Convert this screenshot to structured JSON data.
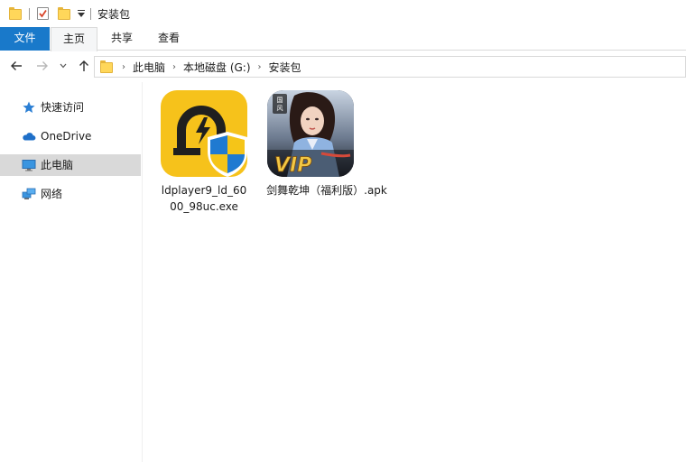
{
  "window": {
    "title": "安装包"
  },
  "ribbon": {
    "tabs": [
      "文件",
      "主页",
      "共享",
      "查看"
    ]
  },
  "address": {
    "crumbs": [
      "此电脑",
      "本地磁盘 (G:)",
      "安装包"
    ]
  },
  "sidebar": {
    "items": [
      {
        "label": "快速访问",
        "icon": "star-icon"
      },
      {
        "label": "OneDrive",
        "icon": "cloud-icon"
      },
      {
        "label": "此电脑",
        "icon": "monitor-icon",
        "selected": true
      },
      {
        "label": "网络",
        "icon": "network-icon"
      }
    ]
  },
  "files": [
    {
      "name_line1": "ldplayer9_ld_60",
      "name_line2": "00_98uc.exe",
      "icon": "ldplayer-app-icon"
    },
    {
      "name_line1": "剑舞乾坤（福利版）.apk",
      "icon": "game-app-icon",
      "badge_text": "VIP",
      "corner_text": "国风"
    }
  ],
  "colors": {
    "accent": "#1979ca",
    "folder": "#ffd75a",
    "selected_bg": "#d9d9d9",
    "ld_yellow": "#f6c21b",
    "shield_blue": "#1f7ad1"
  }
}
